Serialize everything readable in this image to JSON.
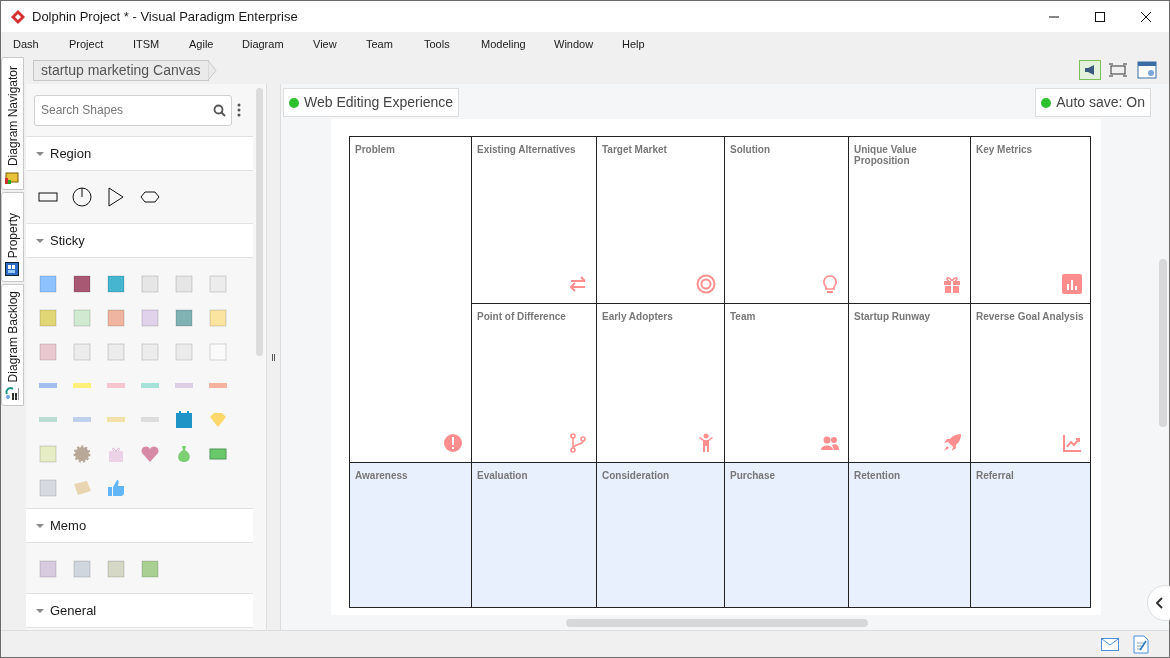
{
  "window": {
    "title": "Dolphin Project * - Visual Paradigm Enterprise"
  },
  "menu": [
    "Dash",
    "Project",
    "ITSM",
    "Agile",
    "Diagram",
    "View",
    "Team",
    "Tools",
    "Modeling",
    "Window",
    "Help"
  ],
  "side_tabs": [
    "Diagram Navigator",
    "Property",
    "Diagram Backlog"
  ],
  "breadcrumb": "startup marketing Canvas",
  "palette": {
    "search": {
      "placeholder": "Search Shapes"
    },
    "sections": [
      "Region",
      "Sticky",
      "Memo",
      "General"
    ]
  },
  "canvas_bar": {
    "mode": "Web Editing Experience",
    "autosave": "Auto save: On"
  },
  "canvas": {
    "cells": [
      {
        "label": "Problem"
      },
      {
        "label": "Existing Alternatives"
      },
      {
        "label": "Target Market"
      },
      {
        "label": "Solution"
      },
      {
        "label": "Unique Value Proposition"
      },
      {
        "label": "Key Metrics"
      },
      {
        "label": "Point of Difference"
      },
      {
        "label": "Early Adopters"
      },
      {
        "label": "Team"
      },
      {
        "label": "Startup Runway"
      },
      {
        "label": "Reverse Goal Analysis"
      },
      {
        "label": "Awareness"
      },
      {
        "label": "Evaluation"
      },
      {
        "label": "Consideration"
      },
      {
        "label": "Purchase"
      },
      {
        "label": "Retention"
      },
      {
        "label": "Referral"
      }
    ]
  }
}
